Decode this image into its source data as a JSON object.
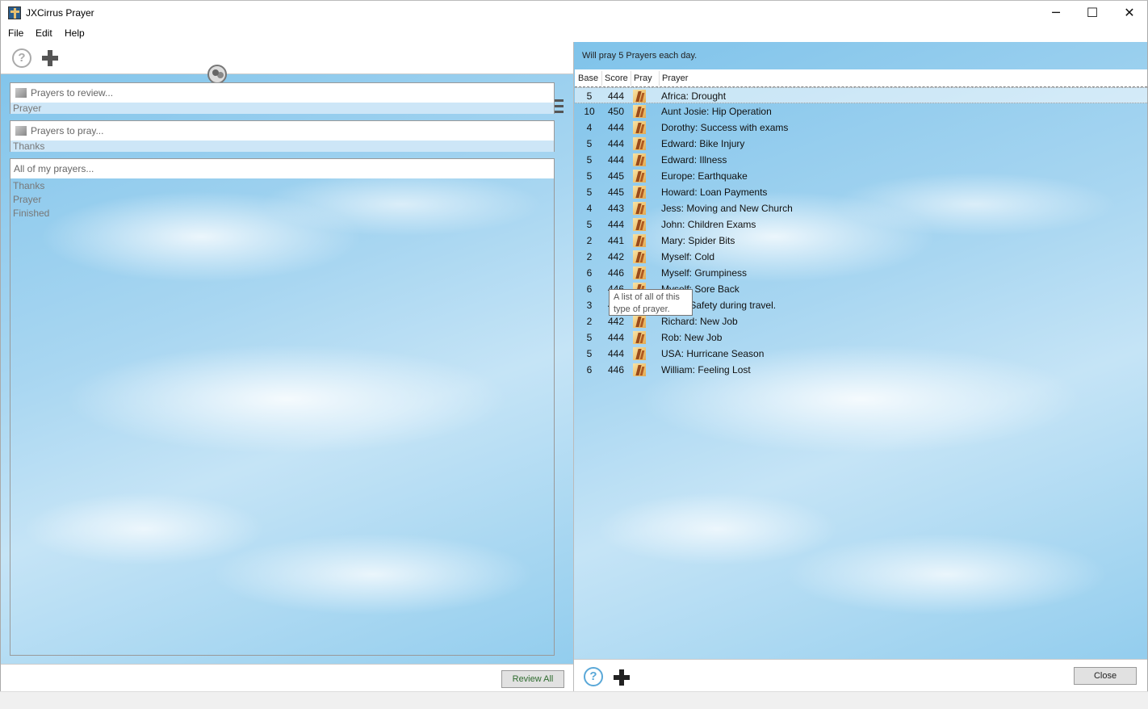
{
  "window": {
    "title": "JXCirrus Prayer",
    "controls": {
      "minimize": "─",
      "maximize": "☐",
      "close": "✕"
    }
  },
  "menu": [
    "File",
    "Edit",
    "Help"
  ],
  "left": {
    "toolbar": [
      "help-icon",
      "add-icon",
      "group-icon",
      "person-icon",
      "menu-icon"
    ],
    "review_box": {
      "header": "Prayers to review...",
      "rows": [
        "Prayer"
      ]
    },
    "pray_box": {
      "header": "Prayers to pray...",
      "rows": [
        "Thanks"
      ]
    },
    "all_box": {
      "header": "All of my prayers...",
      "rows": [
        "Thanks",
        "Prayer",
        "Finished"
      ]
    },
    "review_all_label": "Review All"
  },
  "right": {
    "status": "Will pray 5 Prayers each day.",
    "columns": [
      "Base",
      "Score",
      "Pray",
      "Prayer"
    ],
    "rows": [
      {
        "base": "5",
        "score": "444",
        "prayer": "Africa: Drought"
      },
      {
        "base": "10",
        "score": "450",
        "prayer": "Aunt Josie: Hip Operation"
      },
      {
        "base": "4",
        "score": "444",
        "prayer": "Dorothy: Success with exams"
      },
      {
        "base": "5",
        "score": "444",
        "prayer": "Edward: Bike Injury"
      },
      {
        "base": "5",
        "score": "444",
        "prayer": "Edward: Illness"
      },
      {
        "base": "5",
        "score": "445",
        "prayer": "Europe: Earthquake"
      },
      {
        "base": "5",
        "score": "445",
        "prayer": "Howard: Loan Payments"
      },
      {
        "base": "4",
        "score": "443",
        "prayer": "Jess: Moving and New Church"
      },
      {
        "base": "5",
        "score": "444",
        "prayer": "John: Children Exams"
      },
      {
        "base": "2",
        "score": "441",
        "prayer": "Mary: Spider Bits"
      },
      {
        "base": "2",
        "score": "442",
        "prayer": "Myself: Cold"
      },
      {
        "base": "6",
        "score": "446",
        "prayer": "Myself: Grumpiness"
      },
      {
        "base": "6",
        "score": "446",
        "prayer": "Myself: Sore Back"
      },
      {
        "base": "3",
        "score": "443",
        "prayer": "Peter: Safety during travel."
      },
      {
        "base": "2",
        "score": "442",
        "prayer": "Richard: New Job"
      },
      {
        "base": "5",
        "score": "444",
        "prayer": "Rob: New Job"
      },
      {
        "base": "5",
        "score": "444",
        "prayer": "USA: Hurricane Season"
      },
      {
        "base": "6",
        "score": "446",
        "prayer": "William: Feeling Lost"
      }
    ],
    "tooltip": "A list of all of this type of prayer.",
    "close_label": "Close"
  },
  "colors": {
    "sky": "#8ecbed",
    "selection": "#cde6f7",
    "review_text": "#2e6b2e"
  }
}
